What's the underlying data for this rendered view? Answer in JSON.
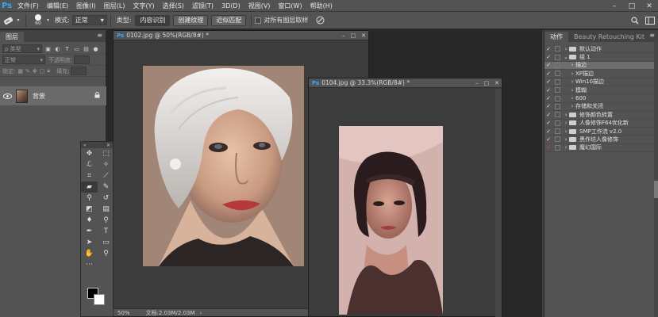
{
  "app": {
    "logo": "Ps"
  },
  "menu": [
    "文件(F)",
    "编辑(E)",
    "图像(I)",
    "图层(L)",
    "文字(Y)",
    "选择(S)",
    "滤镜(T)",
    "3D(D)",
    "视图(V)",
    "窗口(W)",
    "帮助(H)"
  ],
  "options": {
    "brush_size": "60",
    "mode_label": "模式:",
    "mode_value": "正常",
    "type_label": "类型:",
    "type_buttons": [
      "内容识别",
      "创建纹理",
      "近似匹配"
    ],
    "sample_all": "对所有图层取样"
  },
  "layers": {
    "tab": "图层",
    "kind_placeholder": "ρ 类型",
    "blend_mode": "正常",
    "opacity_label": "不透明度:",
    "lock_label": "锁定:",
    "fill_label": "填充:",
    "layer_name": "背景"
  },
  "documents": [
    {
      "title": "0102.jpg @ 50%(RGB/8#) *",
      "zoom": "50%",
      "status": "文档:2.03M/2.03M"
    },
    {
      "title": "0104.jpg @ 33.3%(RGB/8#) *"
    }
  ],
  "actions_panel": {
    "tabs": [
      "动作",
      "Beauty Retouching Kit"
    ],
    "items": [
      {
        "check": "✓",
        "red": false,
        "arrow": "›",
        "folder": true,
        "indent": 0,
        "label": "默认动作",
        "hl": false
      },
      {
        "check": "✓",
        "red": false,
        "arrow": "⌄",
        "folder": true,
        "indent": 0,
        "label": "组 1",
        "hl": false
      },
      {
        "check": "✓",
        "red": false,
        "arrow": "›",
        "folder": false,
        "indent": 1,
        "label": "描边",
        "hl": true
      },
      {
        "check": "✓",
        "red": false,
        "arrow": "›",
        "folder": false,
        "indent": 1,
        "label": "XP描边",
        "hl": false
      },
      {
        "check": "✓",
        "red": false,
        "arrow": "›",
        "folder": false,
        "indent": 1,
        "label": "Win10描边",
        "hl": false
      },
      {
        "check": "✓",
        "red": false,
        "arrow": "›",
        "folder": false,
        "indent": 1,
        "label": "模糊",
        "hl": false
      },
      {
        "check": "✓",
        "red": false,
        "arrow": "›",
        "folder": false,
        "indent": 1,
        "label": "600",
        "hl": false
      },
      {
        "check": "✓",
        "red": false,
        "arrow": "›",
        "folder": false,
        "indent": 1,
        "label": "存储和关闭",
        "hl": false
      },
      {
        "check": "✓",
        "red": false,
        "arrow": "›",
        "folder": true,
        "indent": 0,
        "label": "修饰颜色转置",
        "hl": false
      },
      {
        "check": "✓",
        "red": false,
        "arrow": "›",
        "folder": true,
        "indent": 0,
        "label": "人像修饰F64优化新",
        "hl": false
      },
      {
        "check": "✓",
        "red": false,
        "arrow": "›",
        "folder": true,
        "indent": 0,
        "label": "SMP工作流 v2.0",
        "hl": false
      },
      {
        "check": "✓",
        "red": false,
        "arrow": "›",
        "folder": true,
        "indent": 0,
        "label": "黑作坊人像修饰",
        "hl": false
      },
      {
        "check": "✓",
        "red": true,
        "arrow": "›",
        "folder": true,
        "indent": 0,
        "label": "魔幻国际",
        "hl": false
      }
    ]
  },
  "colors": {
    "accent": "#31a8ff",
    "panel": "#535353",
    "workspace": "#282828",
    "highlight": "#6d6d6d"
  }
}
